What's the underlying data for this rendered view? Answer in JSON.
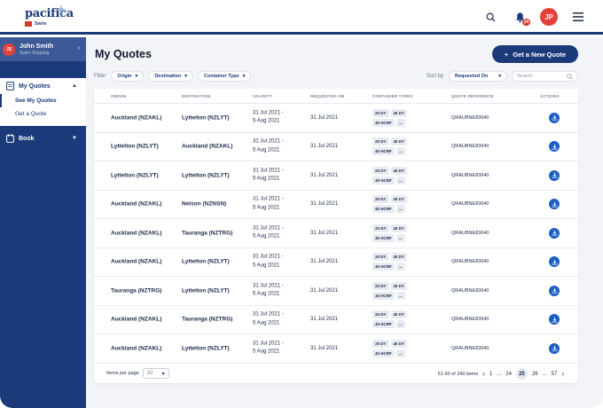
{
  "app": {
    "logo_text": "pacifica",
    "logo_sub": "Swire",
    "notification_count": "24",
    "avatar_initials": "JP"
  },
  "sidebar": {
    "user": {
      "initials": "JS",
      "name": "John Smith",
      "company": "Swire Shipping"
    },
    "quotes_label": "My Quotes",
    "quotes_items": [
      {
        "label": "See My Quotes"
      },
      {
        "label": "Get a Quote"
      }
    ],
    "book_label": "Book"
  },
  "main": {
    "title": "My Quotes",
    "new_quote_label": "Get a New Quote",
    "filter_label": "Filter",
    "filters": [
      {
        "label": "Origin"
      },
      {
        "label": "Destination"
      },
      {
        "label": "Container Type"
      }
    ],
    "sort_label": "Sort by",
    "sort_value": "Requested On",
    "search_placeholder": "Search"
  },
  "table": {
    "columns": [
      "ORIGIN",
      "DESTINATION",
      "VALIDITY",
      "REQUESTED ON",
      "CONTAINER TYPES",
      "QUOTE REFERENCE",
      "ACTIONS"
    ],
    "rows": [
      {
        "origin": "Auckland (NZAKL)",
        "destination": "Lyttelton (NZLYT)",
        "validity_from": "31 Jul 2021 -",
        "validity_to": "5 Aug 2021",
        "requested": "31 Jul 2021",
        "tags": [
          "20 DY",
          "40 DY",
          "40 HCRF",
          "..."
        ],
        "ref": "QRAUBNE83640"
      },
      {
        "origin": "Lyttelton (NZLYT)",
        "destination": "Auckland (NZAKL)",
        "validity_from": "31 Jul 2021 -",
        "validity_to": "5 Aug 2021",
        "requested": "31 Jul 2021",
        "tags": [
          "20 DY",
          "40 DY",
          "40 HCRF",
          "..."
        ],
        "ref": "QRAUBNE83640"
      },
      {
        "origin": "Lyttelton (NZLYT)",
        "destination": "Lyttelton (NZLYT)",
        "validity_from": "31 Jul 2021 -",
        "validity_to": "5 Aug 2021",
        "requested": "31 Jul 2021",
        "tags": [
          "20 DY",
          "40 DY",
          "40 HCRF",
          "..."
        ],
        "ref": "QRAUBNE83640"
      },
      {
        "origin": "Auckland (NZAKL)",
        "destination": "Nelson (NZNSN)",
        "validity_from": "31 Jul 2021 -",
        "validity_to": "5 Aug 2021",
        "requested": "31 Jul 2021",
        "tags": [
          "20 DY",
          "40 DY",
          "40 HCRF",
          "..."
        ],
        "ref": "QRAUBNE83640"
      },
      {
        "origin": "Auckland (NZAKL)",
        "destination": "Tauranga (NZTRG)",
        "validity_from": "31 Jul 2021 -",
        "validity_to": "5 Aug 2021",
        "requested": "31 Jul 2021",
        "tags": [
          "20 DY",
          "40 DY",
          "40 HCRF",
          "..."
        ],
        "ref": "QRAUBNE83640"
      },
      {
        "origin": "Auckland (NZAKL)",
        "destination": "Lyttelton (NZLYT)",
        "validity_from": "31 Jul 2021 -",
        "validity_to": "5 Aug 2021",
        "requested": "31 Jul 2021",
        "tags": [
          "20 DY",
          "40 DY",
          "40 HCRF",
          "..."
        ],
        "ref": "QRAUBNE83640"
      },
      {
        "origin": "Tauranga (NZTRG)",
        "destination": "Lyttelton (NZLYT)",
        "validity_from": "31 Jul 2021 -",
        "validity_to": "5 Aug 2021",
        "requested": "31 Jul 2021",
        "tags": [
          "20 DY",
          "40 DY",
          "40 HCRF",
          "..."
        ],
        "ref": "QRAUBNE83640"
      },
      {
        "origin": "Auckland (NZAKL)",
        "destination": "Tauranga (NZTRG)",
        "validity_from": "31 Jul 2021 -",
        "validity_to": "5 Aug 2021",
        "requested": "31 Jul 2021",
        "tags": [
          "20 DY",
          "40 DY",
          "40 HCRF",
          "..."
        ],
        "ref": "QRAUBNE83640"
      },
      {
        "origin": "Auckland (NZAKL)",
        "destination": "Lyttelton (NZLYT)",
        "validity_from": "31 Jul 2021 -",
        "validity_to": "5 Aug 2021",
        "requested": "31 Jul 2021",
        "tags": [
          "20 DY",
          "40 DY",
          "40 HCRF",
          "..."
        ],
        "ref": "QRAUBNE83640"
      }
    ],
    "items_per_page_label": "Items per page",
    "items_per_page": "10",
    "range_text": "51-60 of 240 items",
    "pages": [
      "1",
      "...",
      "24",
      "25",
      "26",
      "...",
      "57"
    ],
    "active_page": "25"
  },
  "colors": {
    "brand": "#1b3a7a",
    "accent": "#1b5fc4",
    "alert": "#e2423a"
  }
}
